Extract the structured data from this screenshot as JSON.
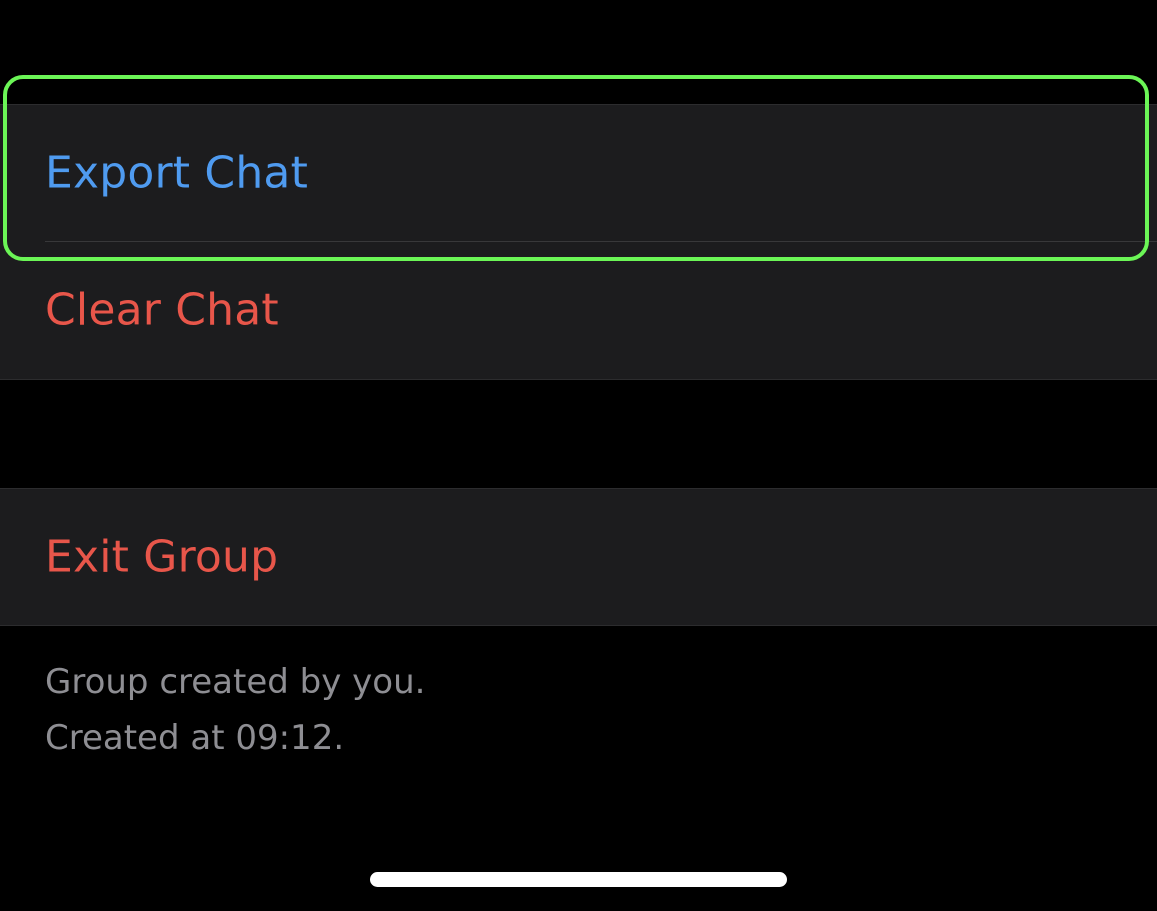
{
  "actions_group": {
    "items": [
      {
        "label": "Export Chat",
        "color": "#4f9bf0"
      },
      {
        "label": "Clear Chat",
        "color": "#e8564a"
      }
    ]
  },
  "danger_group": {
    "items": [
      {
        "label": "Exit Group",
        "color": "#e8564a"
      }
    ]
  },
  "footer": {
    "line1": "Group created by you.",
    "line2": "Created at 09:12."
  },
  "colors": {
    "background": "#000000",
    "cell_background": "#1c1c1e",
    "highlight": "#6bf556",
    "footer_text": "#8e8e93"
  }
}
